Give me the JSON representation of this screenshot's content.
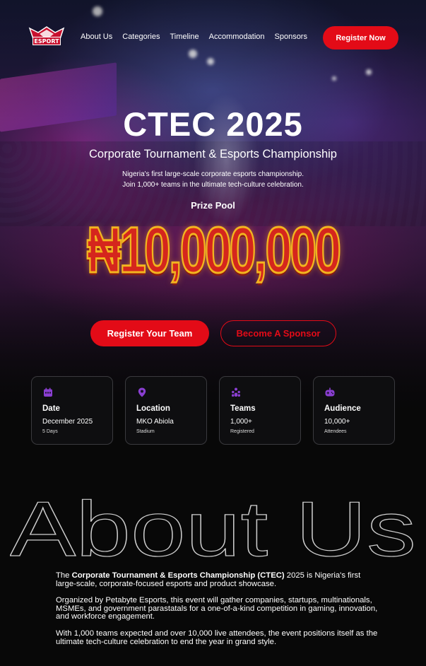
{
  "nav": {
    "logo_text": "ESPORT",
    "links": [
      "About Us",
      "Categories",
      "Timeline",
      "Accommodation",
      "Sponsors"
    ],
    "register_label": "Register Now"
  },
  "hero": {
    "title": "CTEC 2025",
    "subtitle": "Corporate Tournament & Esports Championship",
    "description_line1": "Nigeria's first large-scale corporate esports championship.",
    "description_line2": "Join 1,000+ teams in the ultimate tech-culture celebration.",
    "prize_label": "Prize Pool",
    "prize_amount": "₦10,000,000",
    "cta_primary": "Register Your Team",
    "cta_secondary": "Become A Sponsor"
  },
  "stats": [
    {
      "label": "Date",
      "value": "December 2025",
      "sub": "5 Days",
      "icon": "calendar-icon"
    },
    {
      "label": "Location",
      "value": "MKO Abiola",
      "sub": "Stadium",
      "icon": "location-pin-icon"
    },
    {
      "label": "Teams",
      "value": "1,000+",
      "sub": "Registered",
      "icon": "team-icon"
    },
    {
      "label": "Audience",
      "value": "10,000+",
      "sub": "Attendees",
      "icon": "gamepad-icon"
    }
  ],
  "about": {
    "heading": "About Us",
    "p1_prefix": "The ",
    "p1_bold": "Corporate Tournament & Esports Championship (CTEC)",
    "p1_suffix": " 2025 is Nigeria's first large-scale, corporate-focused esports and product showcase.",
    "p2": "Organized by Petabyte Esports, this event will gather companies, startups, multinationals, MSMEs, and government parastatals for a one-of-a-kind competition in gaming, innovation, and workforce engagement.",
    "p3": "With 1,000 teams expected and over 10,000 live attendees, the event positions itself as the ultimate tech-culture celebration to end the year in grand style."
  },
  "colors": {
    "accent": "#e30b17",
    "icon_purple": "#8a3fd1",
    "card_bg": "#0e0e10"
  }
}
